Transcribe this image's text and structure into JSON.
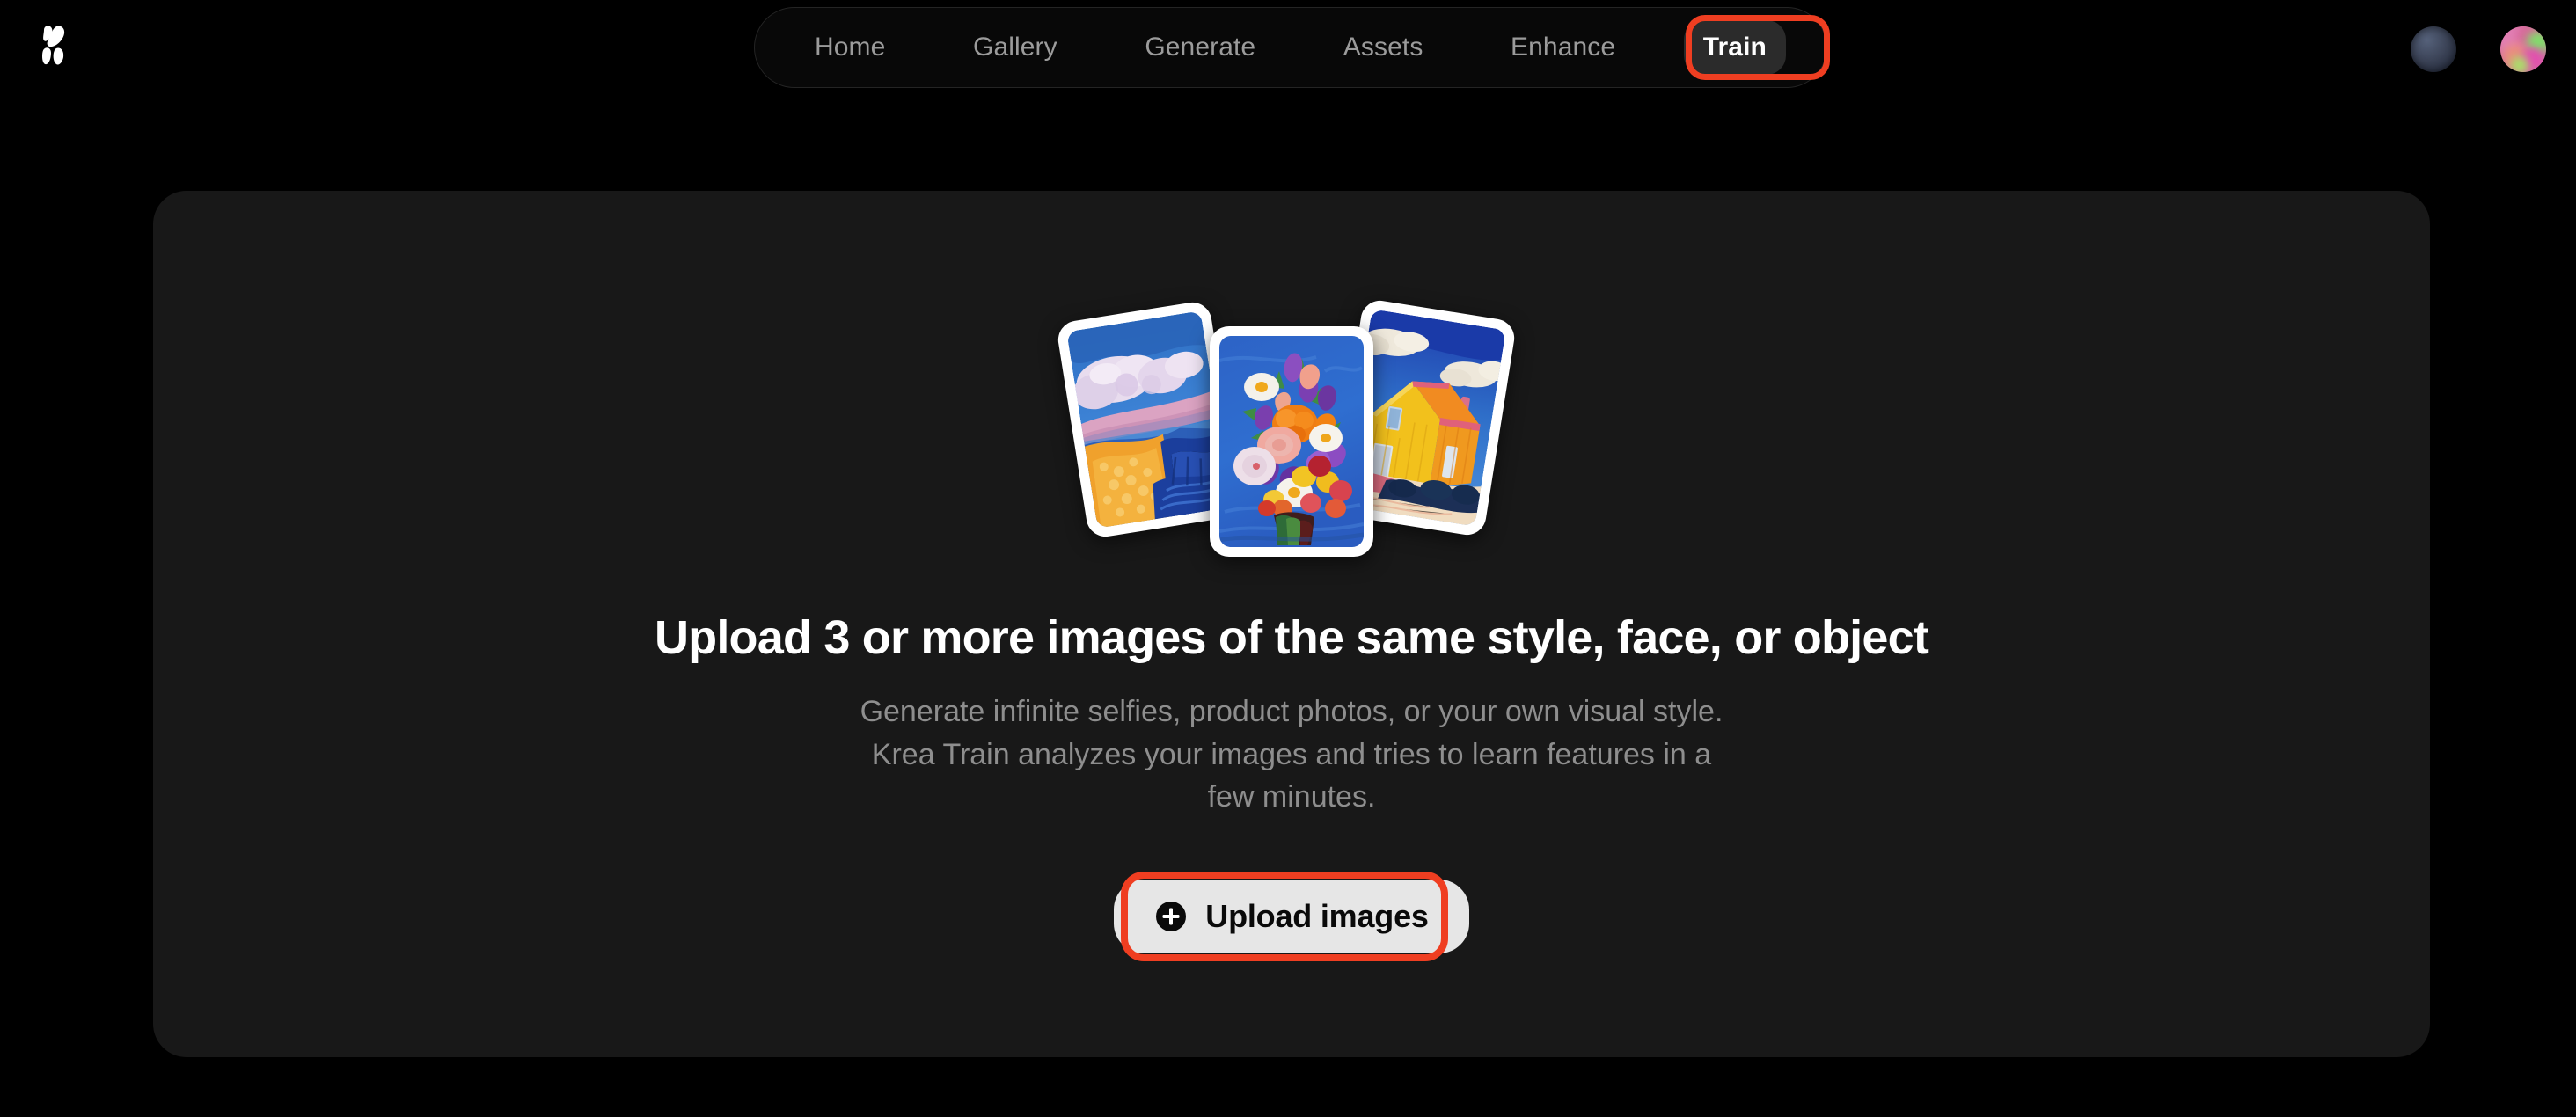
{
  "brand": {
    "logo_icon": "krea-logo-icon",
    "name": "Krea"
  },
  "nav": {
    "items": [
      {
        "label": "Home",
        "active": false
      },
      {
        "label": "Gallery",
        "active": false
      },
      {
        "label": "Generate",
        "active": false
      },
      {
        "label": "Assets",
        "active": false
      },
      {
        "label": "Enhance",
        "active": false
      },
      {
        "label": "Train",
        "active": true
      }
    ]
  },
  "account": {
    "secondary_avatar_icon": "avatar-icon",
    "primary_avatar_icon": "user-avatar-icon"
  },
  "main": {
    "headline": "Upload 3 or more images of the same style, face, or object",
    "subtext": "Generate infinite selfies, product photos, or your own visual style. Krea Train analyzes your images and tries to learn features in a few minutes.",
    "upload_button": {
      "label": "Upload images",
      "icon": "plus-circle-icon"
    },
    "preview_images": [
      {
        "name": "landscape-painting",
        "alt": "Impasto painting of clouds over a wheat field"
      },
      {
        "name": "flowers-painting",
        "alt": "Impasto painting of a colorful flower bouquet"
      },
      {
        "name": "house-painting",
        "alt": "Impasto painting of a yellow house under blue sky"
      }
    ]
  },
  "annotations": {
    "highlight_color": "#ef3e21",
    "targets": [
      "nav-train",
      "upload-images-button"
    ]
  },
  "theme": {
    "page_background": "#000000",
    "card_background": "#181818",
    "nav_background": "#080808",
    "nav_active_background": "#2b2b2b",
    "text_primary": "#ffffff",
    "text_muted": "#8e8e8e",
    "nav_text": "#9b9b9b",
    "button_background": "#e6e6e6"
  }
}
